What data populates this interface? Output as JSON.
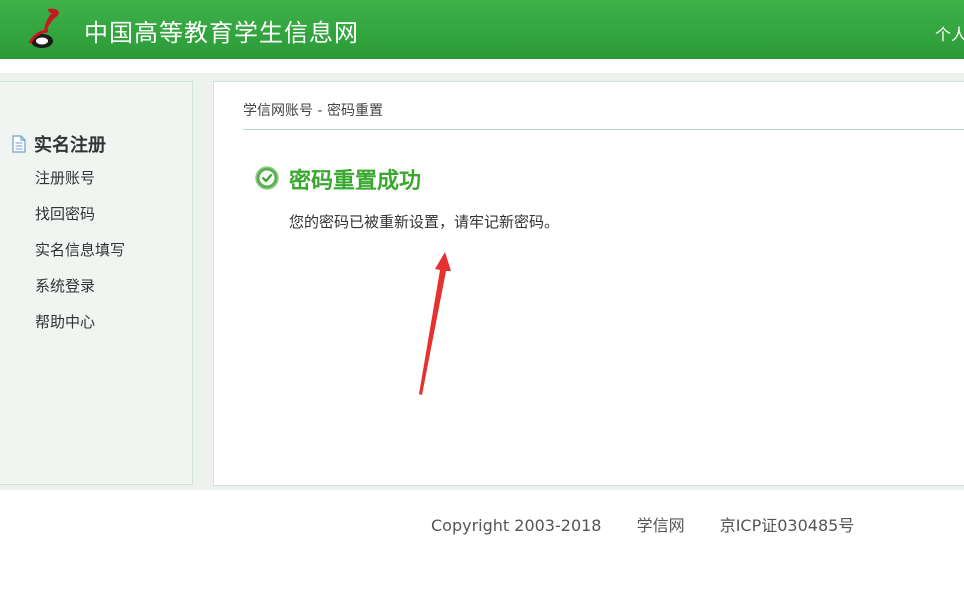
{
  "header": {
    "site_title": "中国高等教育学生信息网",
    "right_link": "个人"
  },
  "sidebar": {
    "title": "实名注册",
    "items": [
      {
        "label": "注册账号"
      },
      {
        "label": "找回密码"
      },
      {
        "label": "实名信息填写"
      },
      {
        "label": "系统登录"
      },
      {
        "label": "帮助中心"
      }
    ]
  },
  "main": {
    "breadcrumb": "学信网账号 - 密码重置",
    "success_title": "密码重置成功",
    "success_message": "您的密码已被重新设置，请牢记新密码。"
  },
  "footer": {
    "copyright": "Copyright 2003-2018",
    "site": "学信网",
    "icp": "京ICP证030485号"
  },
  "colors": {
    "header_green": "#2fa33b",
    "success_green": "#3aa82e",
    "annotation_red": "#e5312f"
  }
}
